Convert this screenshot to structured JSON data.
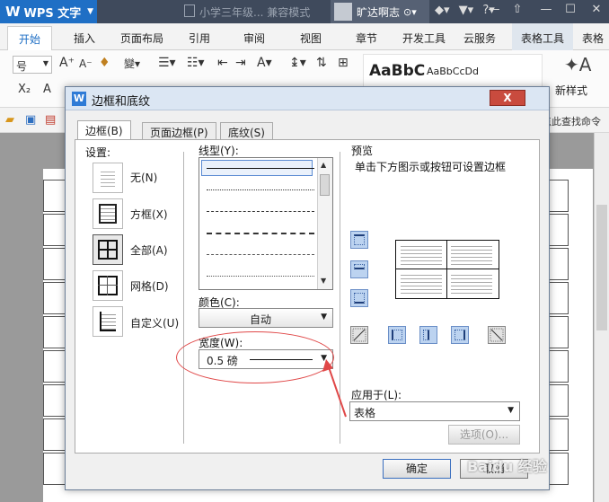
{
  "app": {
    "logo_text": "WPS 文字",
    "document_title": "小学三年级... 兼容模式",
    "user_name": "旷达啊志"
  },
  "ribbon_tabs": [
    "开始",
    "插入",
    "页面布局",
    "引用",
    "审阅",
    "视图",
    "章节",
    "开发工具",
    "云服务",
    "表格工具",
    "表格"
  ],
  "ribbon": {
    "font_size_label": "号",
    "style_sample_big": "AaBbC",
    "style_sample_small": "AaBbCcDd",
    "new_style": "新样式",
    "find_command": "点此查找命令"
  },
  "dialog": {
    "title": "边框和底纹",
    "close_label": "X",
    "tabs": [
      "边框(B)",
      "页面边框(P)",
      "底纹(S)"
    ],
    "settings_label": "设置:",
    "settings": [
      "无(N)",
      "方框(X)",
      "全部(A)",
      "网格(D)",
      "自定义(U)"
    ],
    "line_style_label": "线型(Y):",
    "color_label": "颜色(C):",
    "color_value": "自动",
    "width_label": "宽度(W):",
    "width_value": "0.5 磅",
    "preview_label": "预览",
    "preview_hint": "单击下方图示或按钮可设置边框",
    "apply_to_label": "应用于(L):",
    "apply_to_value": "表格",
    "options_button": "选项(O)...",
    "ok_button": "确定",
    "cancel_button": "取消"
  },
  "watermark": "Baidu 经验",
  "colors": {
    "titlebar": "#3f4a5c",
    "accent": "#1f6fc5",
    "annotation": "#e04848"
  }
}
